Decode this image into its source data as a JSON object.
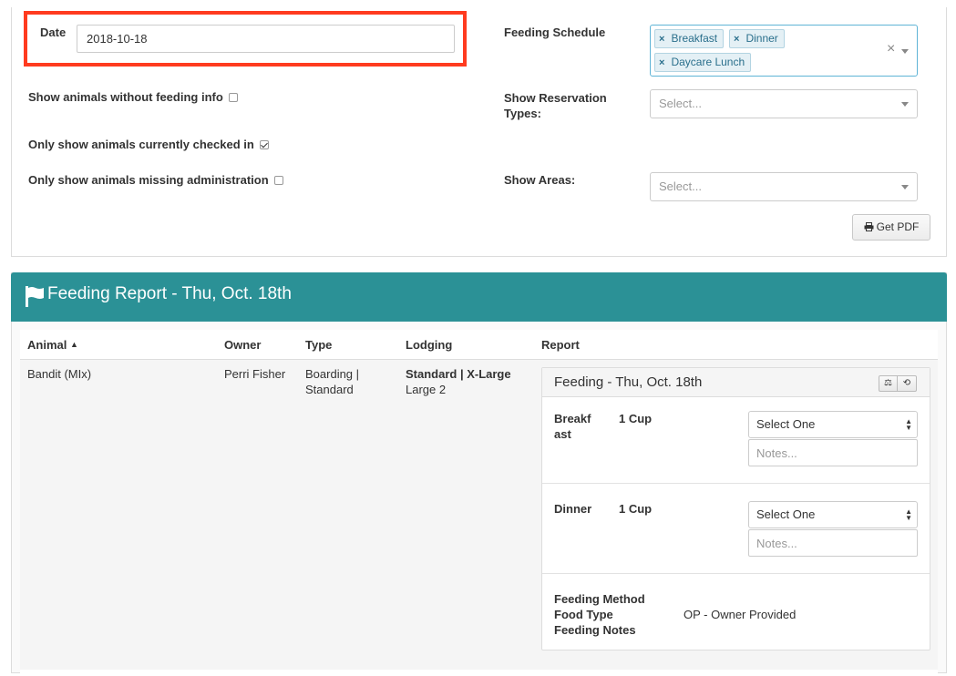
{
  "filters": {
    "date_label": "Date",
    "date_value": "2018-10-18",
    "feeding_schedule_label": "Feeding Schedule",
    "feeding_schedule_tags": [
      "Breakfast",
      "Dinner",
      "Daycare Lunch"
    ],
    "show_without_feeding_label": "Show animals without feeding info",
    "show_without_feeding_checked": false,
    "only_checked_in_label": "Only show animals currently checked in",
    "only_checked_in_checked": true,
    "only_missing_admin_label": "Only show animals missing administration",
    "only_missing_admin_checked": false,
    "reservation_types_label": "Show Reservation Types:",
    "reservation_types_placeholder": "Select...",
    "areas_label": "Show Areas:",
    "areas_placeholder": "Select...",
    "get_pdf_label": "Get PDF",
    "clear_icon": "×"
  },
  "report": {
    "title": "Feeding Report - Thu, Oct. 18th",
    "columns": [
      "Animal",
      "Owner",
      "Type",
      "Lodging",
      "Report"
    ],
    "sort_indicator": "▲",
    "rows": [
      {
        "animal": "Bandit (MIx)",
        "owner": "Perri Fisher",
        "type_line1": "Boarding |",
        "type_line2": "Standard",
        "lodging_bold": "Standard | X-Large",
        "lodging_sub": "Large 2",
        "feeding": {
          "title": "Feeding - Thu, Oct. 18th",
          "meals": [
            {
              "name_line1": "Breakf",
              "name_line2": "ast",
              "amount": "1 Cup",
              "select": "Select One",
              "notes_placeholder": "Notes..."
            },
            {
              "name_line1": "Dinner",
              "name_line2": "",
              "amount": "1 Cup",
              "select": "Select One",
              "notes_placeholder": "Notes..."
            }
          ],
          "method_label": "Feeding Method",
          "food_type_label": "Food Type",
          "notes_label": "Feeding Notes",
          "food_type_value": "OP - Owner Provided"
        }
      }
    ]
  },
  "colors": {
    "header_teal": "#2b9196",
    "highlight_red": "#ff3b1f",
    "tag_text": "#2a6f8c"
  }
}
